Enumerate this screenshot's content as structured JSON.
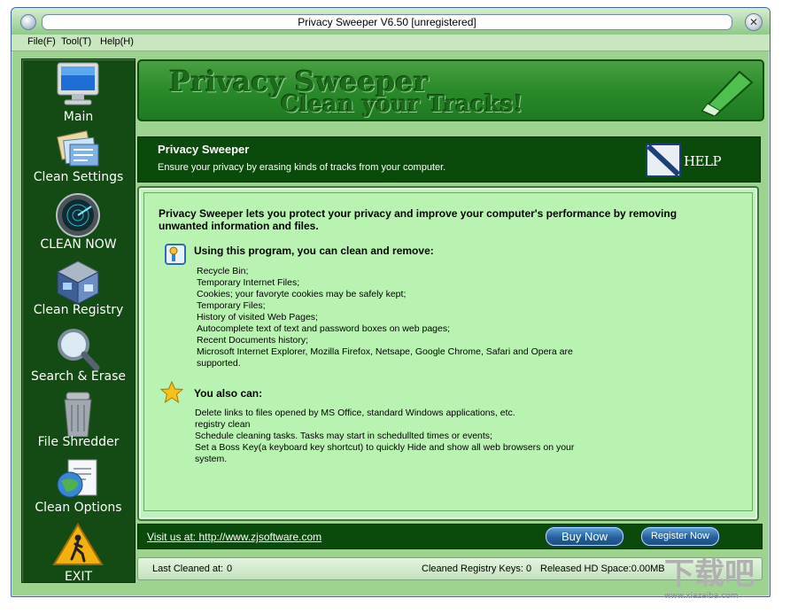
{
  "window": {
    "title": "Privacy Sweeper V6.50 [unregistered]"
  },
  "menu": [
    "File(F)",
    "Tool(T)",
    "Help(H)"
  ],
  "sidebar": {
    "items": [
      {
        "label": "Main",
        "icon": "monitor-icon"
      },
      {
        "label": "Clean Settings",
        "icon": "settings-folders-icon"
      },
      {
        "label": "CLEAN NOW",
        "icon": "radar-icon"
      },
      {
        "label": "Clean Registry",
        "icon": "registry-cube-icon"
      },
      {
        "label": "Search & Erase",
        "icon": "magnifier-icon"
      },
      {
        "label": "File Shredder",
        "icon": "trash-can-icon"
      },
      {
        "label": "Clean Options",
        "icon": "globe-document-icon"
      },
      {
        "label": "EXIT",
        "icon": "exit-warning-icon"
      }
    ]
  },
  "banner": {
    "line1": "Privacy Sweeper",
    "line2": "Clean your Tracks!"
  },
  "header": {
    "title": "Privacy Sweeper",
    "subtitle": "Ensure your privacy by erasing kinds of tracks from your computer.",
    "help_label": "HELP"
  },
  "content": {
    "intro": "Privacy Sweeper lets you protect your privacy and improve your computer's performance by removing unwanted information and files.",
    "section1": {
      "heading": "Using this program, you can clean and remove:",
      "items": [
        "Recycle Bin;",
        "Temporary Internet Files;",
        "Cookies; your favoryte cookies may be safely kept;",
        "Temporary Files;",
        "History of visited Web Pages;",
        "Autocomplete text of text and password boxes on web pages;",
        "Recent Documents history;",
        "Microsoft Internet Explorer, Mozilla Firefox, Netsape, Google Chrome, Safari and Opera are supported."
      ]
    },
    "section2": {
      "heading": "You also can:",
      "items": [
        "Delete links to files opened by MS Office, standard Windows applications, etc.",
        "registry clean",
        "Schedule cleaning tasks. Tasks may start in schedullted times or events;",
        "Set a Boss Key(a keyboard key shortcut) to quickly Hide and show all web browsers on your system."
      ]
    }
  },
  "footer": {
    "visit": "Visit us at: http://www.zjsoftware.com",
    "buy_now": "Buy Now",
    "register_now": "Register Now"
  },
  "status": {
    "last_cleaned_label": "Last Cleaned at:",
    "last_cleaned_value": "0",
    "registry_keys": "Cleaned Registry Keys: 0",
    "hd_space": "Released HD Space:0.00MB"
  },
  "watermark": {
    "text": "下载吧",
    "url": "www.xiazaiba.com"
  },
  "colors": {
    "sidebar_bg": "#144a14",
    "content_bg": "#b9f3b2",
    "accent_green": "#2a8a2a",
    "button_blue": "#25609d"
  }
}
